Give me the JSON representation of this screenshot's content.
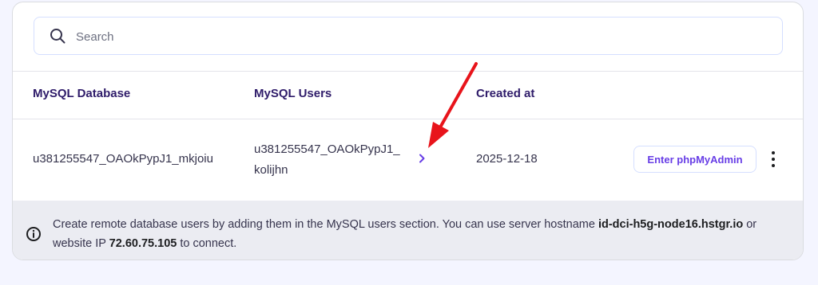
{
  "search": {
    "placeholder": "Search",
    "icon": "search-icon"
  },
  "table": {
    "columns": [
      "MySQL Database",
      "MySQL Users",
      "Created at"
    ],
    "rows": [
      {
        "database": "u381255547_OAOkPypJ1_mkjoiu",
        "user_line1": "u381255547_OAOkPypJ1_",
        "user_line2": "kolijhn",
        "created_at": "2025-12-18",
        "action_label": "Enter phpMyAdmin"
      }
    ]
  },
  "notice": {
    "text_before": "Create remote database users by adding them in the MySQL users section. You can use server hostname ",
    "hostname": "id-dci-h5g-node16.hstgr.io",
    "text_middle": " or website IP ",
    "ip": "72.60.75.105",
    "text_after": " to connect."
  },
  "colors": {
    "accent": "#673de6",
    "annotation_arrow": "#e8141b",
    "notice_bg": "#ebecf2"
  }
}
